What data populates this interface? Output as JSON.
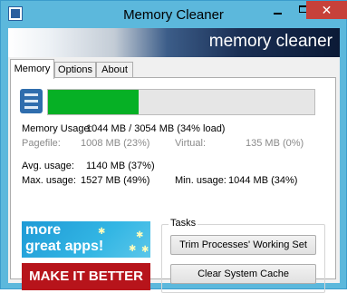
{
  "window": {
    "title": "Memory Cleaner",
    "close_glyph": "✕",
    "banner_text": "memory cleaner"
  },
  "tabs": [
    {
      "label": "Memory",
      "active": true
    },
    {
      "label": "Options",
      "active": false
    },
    {
      "label": "About",
      "active": false
    }
  ],
  "memory": {
    "usage_fraction": 0.34,
    "usage_label": "Memory Usage:",
    "usage_value": "1044 MB / 3054 MB  (34% load)",
    "pagefile_label": "Pagefile:",
    "pagefile_value": "1008 MB (23%)",
    "virtual_label": "Virtual:",
    "virtual_value": "135 MB (0%)",
    "avg_label": "Avg. usage:",
    "avg_value": "1140 MB (37%)",
    "max_label": "Max. usage:",
    "max_value": "1527 MB (49%)",
    "min_label": "Min. usage:",
    "min_value": "1044 MB (34%)"
  },
  "ads": {
    "more_apps_line1": "more",
    "more_apps_line2": "great apps!",
    "make_better": "MAKE IT BETTER"
  },
  "tasks": {
    "legend": "Tasks",
    "trim_button": "Trim Processes' Working Set",
    "clear_button": "Clear System Cache"
  },
  "colors": {
    "progress": "#06b025",
    "titlebar": "#5cb8dc",
    "close": "#c7413a",
    "ad_red": "#b7141b"
  },
  "icons": {
    "app": "app-icon",
    "memory": "memory-chip-icon"
  }
}
